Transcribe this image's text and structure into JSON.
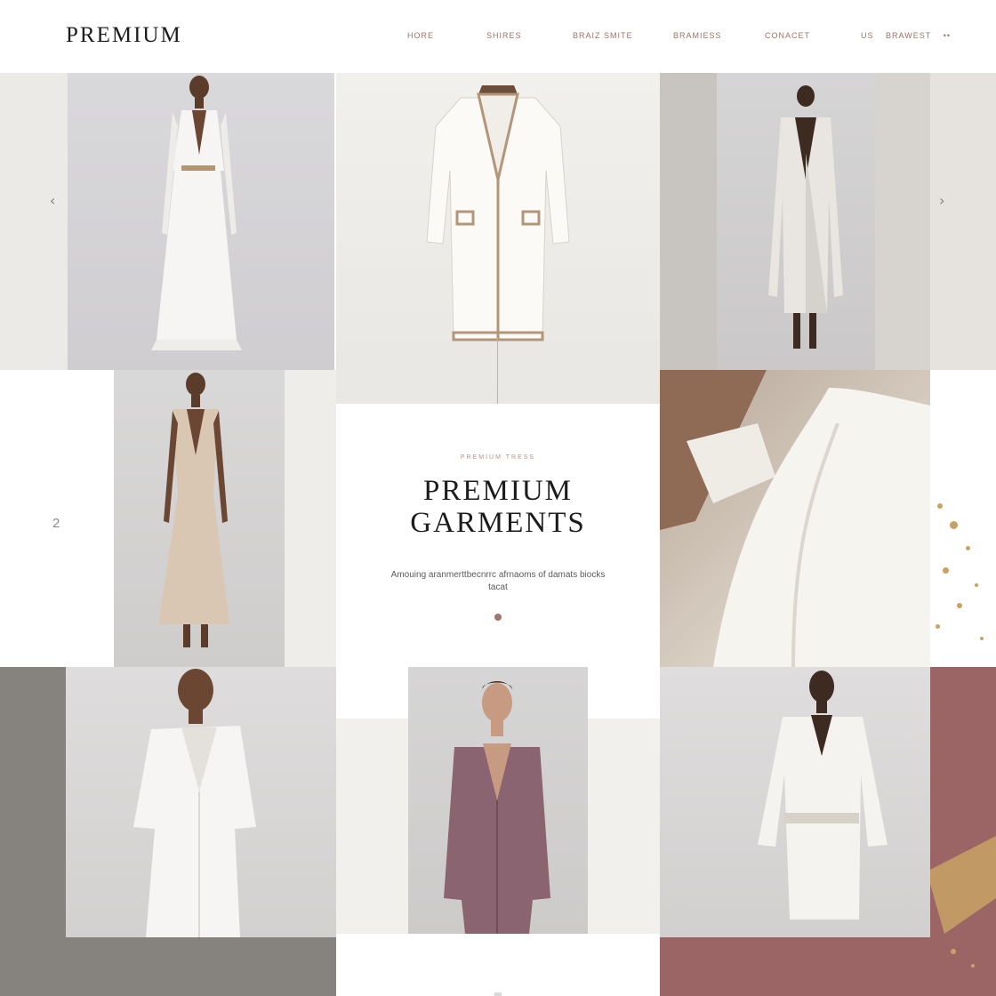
{
  "header": {
    "brand": "PREMIUM",
    "nav": [
      "HORE",
      "SHIRES",
      "BRAIZ SMITE",
      "BRAMIESS",
      "CONACET"
    ],
    "extras": [
      "US",
      "BRAWEST",
      "••"
    ]
  },
  "feature": {
    "eyebrow": "PREMIUM TRESS",
    "title_line1": "PREMIUM",
    "title_line2": "GARMENTS",
    "description": "Amouing aranmerttbecnrrc afrnaoms of damats biocks tacat"
  },
  "carousel": {
    "prev_arrow": "‹",
    "next_arrow": "›",
    "page": "2"
  },
  "colors": {
    "accent": "#9a7468",
    "brand_text": "#1d1d1d",
    "rose_panel": "#9c6565",
    "taupe_panel": "#86827d"
  }
}
